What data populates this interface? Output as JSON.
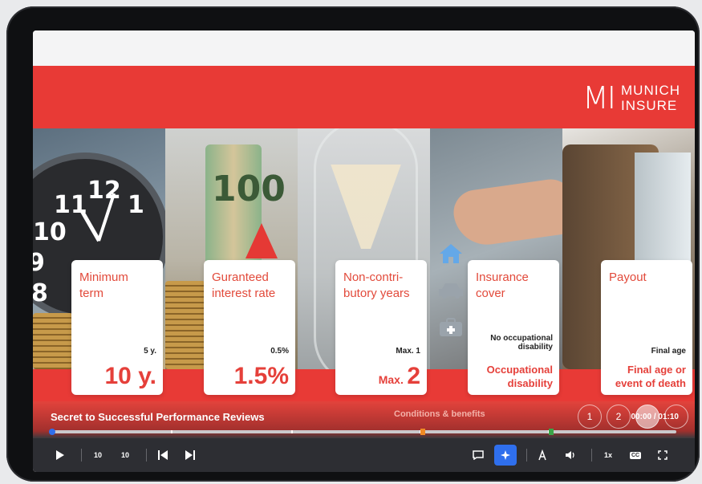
{
  "brand": {
    "mark": "MI",
    "line1": "MUNICH",
    "line2": "INSURE"
  },
  "cards": [
    {
      "title": "Minimum term",
      "small": "5 y.",
      "big": "10 y."
    },
    {
      "title": "Guranteed interest rate",
      "small": "0.5%",
      "big": "1.5%"
    },
    {
      "title": "Non-contri-butory years",
      "small": "Max. 1",
      "big_prefix": "Max.",
      "big": "2"
    },
    {
      "title": "Insurance cover",
      "small": "No occupational disability",
      "big": "Occupational disability"
    },
    {
      "title": "Payout",
      "small": "Final age",
      "big": "Final age or event of death"
    }
  ],
  "clock_numbers": [
    "12",
    "11",
    "10",
    "9",
    "8",
    "1"
  ],
  "roll_text": "100",
  "lesson_title": "Secret to Successful Performance Reviews",
  "section_title": "Conditions & benefits",
  "nav_dots": [
    "1",
    "2",
    "",
    ""
  ],
  "time": "00:00 / 01:10",
  "progress": {
    "fraction": 0.0
  },
  "controls": {
    "rewind_label": "10",
    "forward_label": "10",
    "speed_label": "1x",
    "cc_label": "CC"
  },
  "colors": {
    "brand_red": "#e83a36",
    "accent_blue": "#2f6fed"
  },
  "icons": [
    "play-icon",
    "rewind-10-icon",
    "forward-10-icon",
    "skip-back-icon",
    "skip-forward-icon",
    "chat-icon",
    "sparkle-icon",
    "text-size-icon",
    "volume-icon",
    "speed-icon",
    "captions-icon",
    "fullscreen-icon",
    "home-icon",
    "car-icon",
    "medical-case-icon"
  ]
}
